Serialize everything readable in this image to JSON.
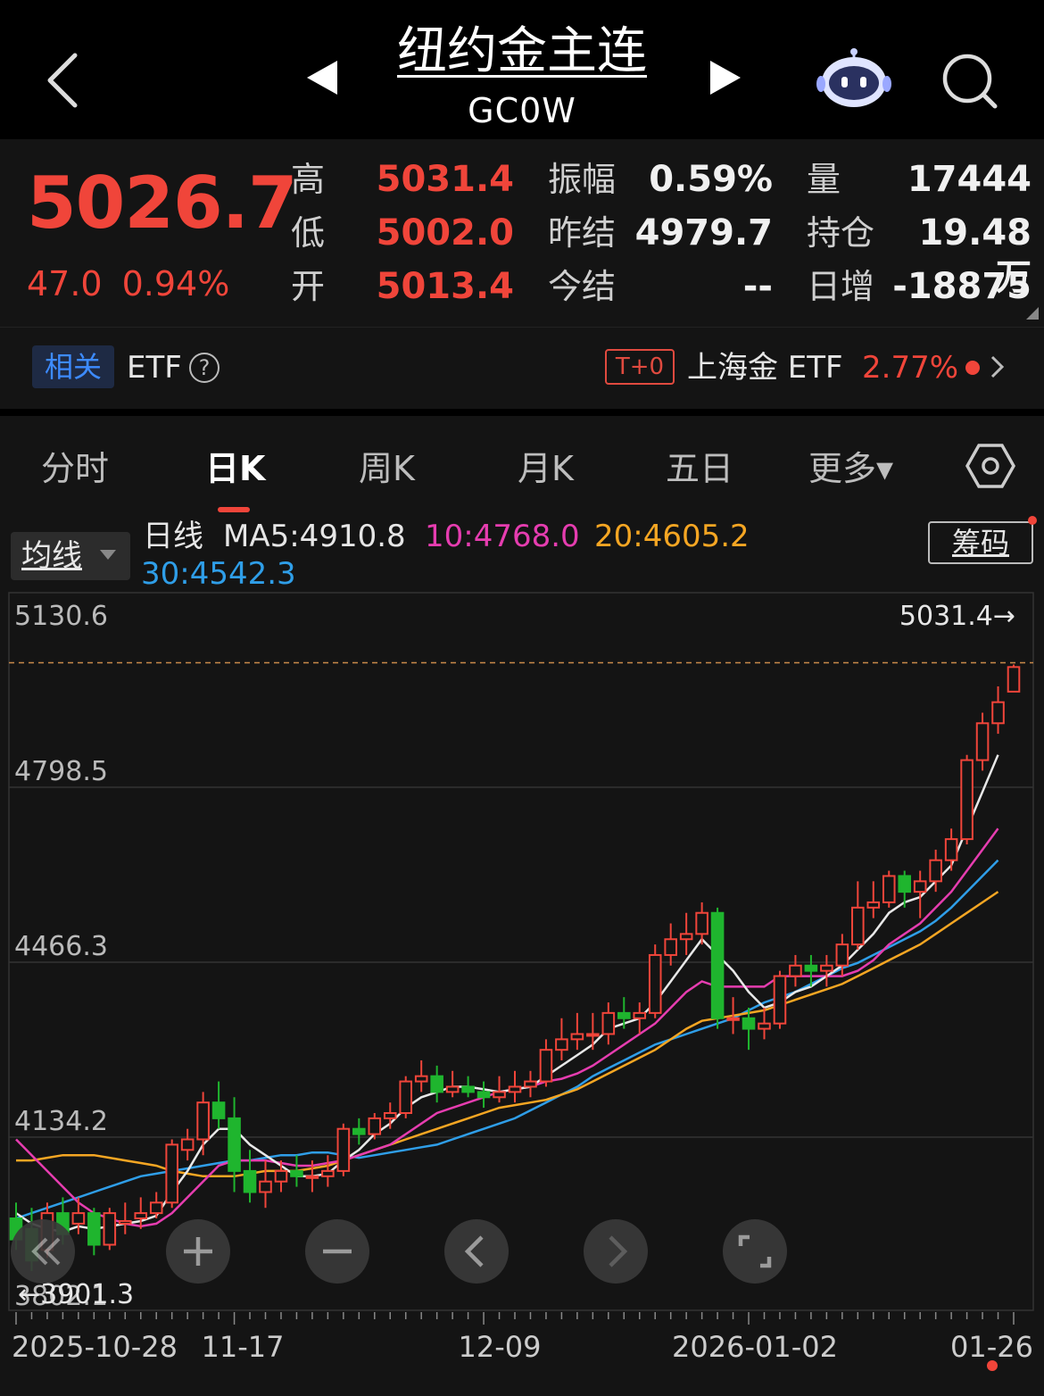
{
  "header": {
    "title": "纽约金主连",
    "code": "GC0W"
  },
  "quote": {
    "price": "5026.7",
    "change": "47.0",
    "change_pct": "0.94%",
    "fields": [
      {
        "label": "高",
        "value": "5031.4",
        "color": "red"
      },
      {
        "label": "低",
        "value": "5002.0",
        "color": "red"
      },
      {
        "label": "开",
        "value": "5013.4",
        "color": "red"
      },
      {
        "label": "振幅",
        "value": "0.59%",
        "color": "white"
      },
      {
        "label": "昨结",
        "value": "4979.7",
        "color": "white"
      },
      {
        "label": "今结",
        "value": "--",
        "color": "white"
      },
      {
        "label": "量",
        "value": "17444",
        "color": "white"
      },
      {
        "label": "持仓",
        "value": "19.48万",
        "color": "white"
      },
      {
        "label": "日增",
        "value": "-18875",
        "color": "white"
      }
    ]
  },
  "etf": {
    "related_badge": "相关",
    "label": "ETF",
    "help": "?",
    "t0_badge": "T+0",
    "name": "上海金 ETF",
    "pct": "2.77%"
  },
  "tabs": [
    {
      "label": "分时",
      "active": false
    },
    {
      "label": "日K",
      "active": true
    },
    {
      "label": "周K",
      "active": false
    },
    {
      "label": "月K",
      "active": false
    },
    {
      "label": "五日",
      "active": false
    },
    {
      "label": "更多▾",
      "active": false
    }
  ],
  "indicator": {
    "selector": "均线",
    "line_label": "日线",
    "ma5": "MA5:4910.8",
    "ma10": "10:4768.0",
    "ma20": "20:4605.2",
    "ma30": "30:4542.3",
    "chip_button": "筹码"
  },
  "colors": {
    "up": "#f0453a",
    "down": "#1fb52e",
    "ma5": "#e8e8e8",
    "ma10": "#e63db0",
    "ma20": "#f5a623",
    "ma30": "#2f9ee8"
  },
  "chart_data": {
    "type": "candlestick",
    "y_ticks": [
      "5130.6",
      "4798.5",
      "4466.3",
      "4134.2",
      "3802.1"
    ],
    "ylim": [
      3802.1,
      5130.6
    ],
    "x_ticks": [
      "2025-10-28",
      "11-17",
      "12-09",
      "2026-01-02",
      "01-26"
    ],
    "high_marker": "5031.4→",
    "low_marker": "←3901.3",
    "candles": [
      [
        3980,
        3940,
        4010,
        3920
      ],
      [
        3960,
        3900,
        4000,
        3880
      ],
      [
        3920,
        3990,
        4010,
        3905
      ],
      [
        3990,
        3950,
        4020,
        3930
      ],
      [
        3970,
        3990,
        4020,
        3950
      ],
      [
        3990,
        3930,
        4000,
        3910
      ],
      [
        3930,
        3990,
        4000,
        3920
      ],
      [
        3970,
        3975,
        4010,
        3950
      ],
      [
        3980,
        3990,
        4020,
        3960
      ],
      [
        3990,
        4010,
        4030,
        3980
      ],
      [
        4010,
        4120,
        4130,
        4000
      ],
      [
        4110,
        4130,
        4150,
        4090
      ],
      [
        4130,
        4200,
        4220,
        4100
      ],
      [
        4200,
        4170,
        4240,
        4150
      ],
      [
        4170,
        4070,
        4210,
        4030
      ],
      [
        4070,
        4030,
        4110,
        4010
      ],
      [
        4030,
        4050,
        4090,
        4000
      ],
      [
        4050,
        4070,
        4090,
        4030
      ],
      [
        4070,
        4060,
        4100,
        4040
      ],
      [
        4060,
        4060,
        4090,
        4030
      ],
      [
        4060,
        4070,
        4100,
        4040
      ],
      [
        4070,
        4150,
        4160,
        4060
      ],
      [
        4150,
        4140,
        4170,
        4120
      ],
      [
        4140,
        4170,
        4180,
        4130
      ],
      [
        4170,
        4180,
        4200,
        4150
      ],
      [
        4180,
        4240,
        4250,
        4170
      ],
      [
        4240,
        4250,
        4280,
        4220
      ],
      [
        4250,
        4220,
        4270,
        4200
      ],
      [
        4220,
        4230,
        4260,
        4210
      ],
      [
        4230,
        4220,
        4250,
        4210
      ],
      [
        4220,
        4210,
        4240,
        4190
      ],
      [
        4210,
        4220,
        4250,
        4200
      ],
      [
        4220,
        4230,
        4260,
        4200
      ],
      [
        4230,
        4240,
        4260,
        4210
      ],
      [
        4240,
        4300,
        4320,
        4230
      ],
      [
        4300,
        4320,
        4360,
        4280
      ],
      [
        4320,
        4330,
        4370,
        4300
      ],
      [
        4330,
        4330,
        4370,
        4300
      ],
      [
        4330,
        4370,
        4390,
        4310
      ],
      [
        4370,
        4360,
        4400,
        4340
      ],
      [
        4360,
        4370,
        4390,
        4330
      ],
      [
        4370,
        4480,
        4500,
        4360
      ],
      [
        4480,
        4510,
        4540,
        4460
      ],
      [
        4510,
        4520,
        4560,
        4480
      ],
      [
        4520,
        4560,
        4580,
        4500
      ],
      [
        4560,
        4360,
        4570,
        4340
      ],
      [
        4360,
        4360,
        4400,
        4330
      ],
      [
        4360,
        4340,
        4380,
        4300
      ],
      [
        4340,
        4350,
        4380,
        4320
      ],
      [
        4350,
        4440,
        4450,
        4340
      ],
      [
        4440,
        4460,
        4480,
        4420
      ],
      [
        4460,
        4450,
        4480,
        4420
      ],
      [
        4450,
        4460,
        4480,
        4420
      ],
      [
        4460,
        4500,
        4520,
        4440
      ],
      [
        4500,
        4570,
        4620,
        4490
      ],
      [
        4570,
        4580,
        4620,
        4550
      ],
      [
        4580,
        4630,
        4640,
        4570
      ],
      [
        4630,
        4600,
        4640,
        4570
      ],
      [
        4600,
        4620,
        4640,
        4550
      ],
      [
        4620,
        4660,
        4680,
        4600
      ],
      [
        4660,
        4700,
        4720,
        4640
      ],
      [
        4700,
        4850,
        4860,
        4690
      ],
      [
        4850,
        4920,
        4940,
        4830
      ],
      [
        4920,
        4960,
        4990,
        4900
      ],
      [
        4980,
        5026.7,
        5031.4,
        5002.0
      ]
    ],
    "ma5": [
      3990,
      3970,
      3960,
      3955,
      3965,
      3960,
      3965,
      3970,
      3975,
      3985,
      4030,
      4070,
      4120,
      4150,
      4150,
      4120,
      4100,
      4080,
      4060,
      4060,
      4065,
      4090,
      4110,
      4140,
      4160,
      4190,
      4210,
      4220,
      4230,
      4230,
      4225,
      4220,
      4225,
      4230,
      4250,
      4270,
      4290,
      4310,
      4340,
      4350,
      4360,
      4390,
      4430,
      4470,
      4510,
      4480,
      4450,
      4410,
      4380,
      4390,
      4410,
      4420,
      4440,
      4460,
      4490,
      4520,
      4560,
      4580,
      4590,
      4620,
      4650,
      4720,
      4790,
      4860,
      4910.8
    ],
    "ma10": [
      4130,
      4100,
      4070,
      4040,
      4010,
      3990,
      3980,
      3970,
      3965,
      3970,
      3990,
      4020,
      4050,
      4080,
      4090,
      4090,
      4090,
      4085,
      4080,
      4080,
      4085,
      4090,
      4100,
      4110,
      4120,
      4140,
      4160,
      4180,
      4190,
      4200,
      4210,
      4220,
      4225,
      4230,
      4240,
      4245,
      4255,
      4270,
      4290,
      4310,
      4330,
      4350,
      4380,
      4410,
      4430,
      4420,
      4420,
      4420,
      4420,
      4440,
      4440,
      4440,
      4440,
      4440,
      4450,
      4470,
      4500,
      4520,
      4540,
      4570,
      4600,
      4640,
      4680,
      4720,
      4768.0
    ],
    "ma20": [
      4090,
      4090,
      4095,
      4100,
      4100,
      4100,
      4095,
      4090,
      4085,
      4080,
      4070,
      4065,
      4060,
      4060,
      4060,
      4065,
      4070,
      4070,
      4070,
      4075,
      4080,
      4090,
      4100,
      4110,
      4120,
      4130,
      4140,
      4150,
      4160,
      4170,
      4180,
      4190,
      4195,
      4200,
      4205,
      4215,
      4225,
      4240,
      4255,
      4270,
      4285,
      4300,
      4320,
      4340,
      4355,
      4360,
      4365,
      4370,
      4375,
      4385,
      4395,
      4405,
      4415,
      4425,
      4440,
      4455,
      4470,
      4485,
      4500,
      4520,
      4540,
      4560,
      4580,
      4600,
      4605.2
    ],
    "ma30": [
      3980,
      3990,
      4000,
      4010,
      4020,
      4030,
      4040,
      4050,
      4060,
      4065,
      4070,
      4075,
      4080,
      4085,
      4090,
      4090,
      4095,
      4100,
      4100,
      4105,
      4105,
      4100,
      4095,
      4100,
      4105,
      4110,
      4115,
      4120,
      4130,
      4140,
      4150,
      4160,
      4170,
      4185,
      4200,
      4215,
      4230,
      4250,
      4265,
      4280,
      4295,
      4310,
      4320,
      4330,
      4340,
      4350,
      4360,
      4375,
      4390,
      4400,
      4410,
      4425,
      4440,
      4455,
      4465,
      4480,
      4495,
      4510,
      4525,
      4545,
      4570,
      4600,
      4630,
      4660,
      4542.3
    ]
  },
  "controls": [
    "rewind-icon",
    "zoom-in-icon",
    "zoom-out-icon",
    "prev-icon",
    "next-icon",
    "fullscreen-icon"
  ]
}
